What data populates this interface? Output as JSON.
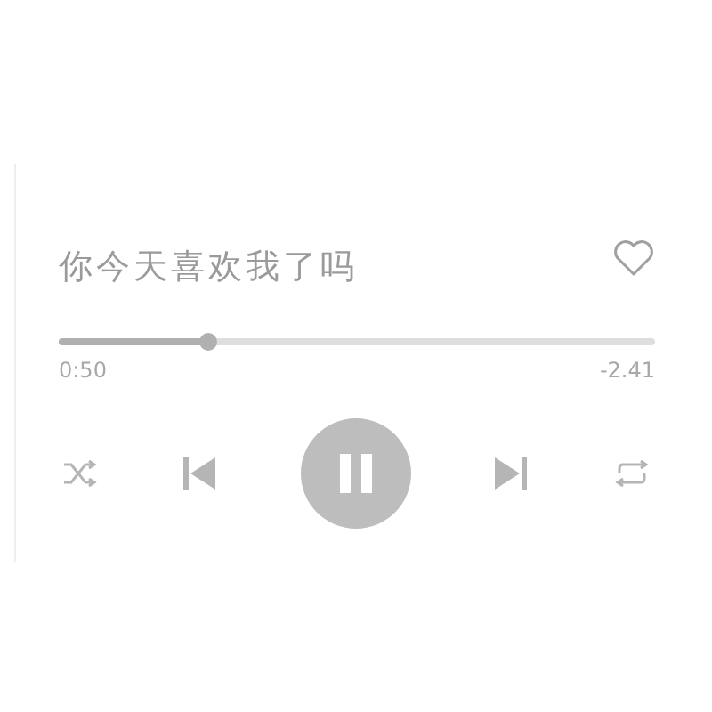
{
  "player": {
    "title": "你今天喜欢我了吗",
    "liked": false,
    "progress": {
      "level": 0.25,
      "elapsed": "0:50",
      "remaining": "-2.41"
    },
    "playing": true
  }
}
